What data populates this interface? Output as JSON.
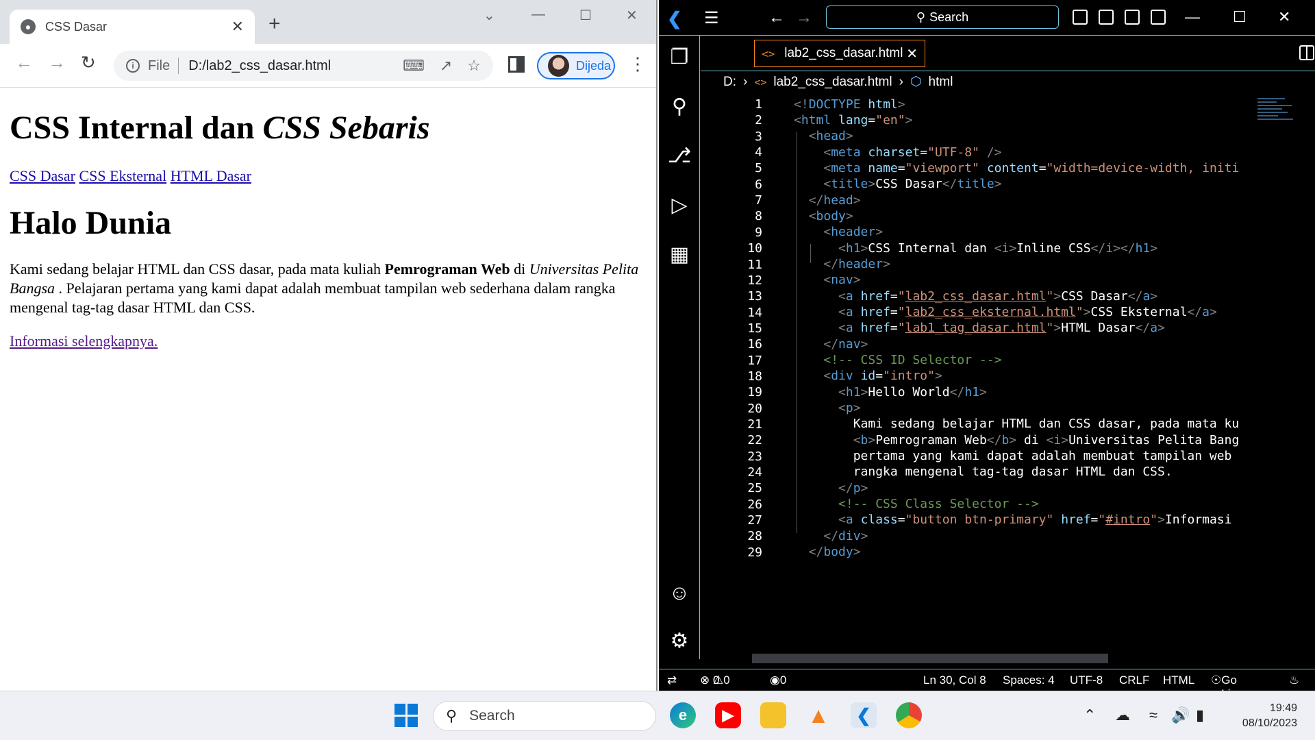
{
  "browser": {
    "tab_title": "CSS Dasar",
    "omnibox_scheme": "File",
    "url": "D:/lab2_css_dasar.html",
    "profile_name": "Dijeda",
    "page": {
      "h1_plain": "CSS Internal dan ",
      "h1_italic": "CSS Sebaris",
      "nav_links": [
        "CSS Dasar",
        "CSS Eksternal",
        "HTML Dasar"
      ],
      "h2": "Halo Dunia",
      "p_part1": "Kami sedang belajar HTML dan CSS dasar, pada mata kuliah ",
      "p_bold": "Pemrograman Web",
      "p_part2": " di ",
      "p_italic": "Universitas Pelita Bangsa",
      "p_part3": " . Pelajaran pertama yang kami dapat adalah membuat tampilan web sederhana dalam rangka mengenal tag-tag dasar HTML dan CSS.",
      "more_link": "Informasi selengkapnya."
    }
  },
  "vscode": {
    "search_label": "Search",
    "file_tab": "lab2_css_dasar.html",
    "breadcrumb": [
      "D:",
      "lab2_css_dasar.html",
      "html"
    ],
    "line_numbers": [
      "1",
      "2",
      "3",
      "4",
      "5",
      "6",
      "7",
      "8",
      "9",
      "10",
      "11",
      "12",
      "13",
      "14",
      "15",
      "16",
      "17",
      "18",
      "19",
      "20",
      "21",
      "22",
      "23",
      "24",
      "25",
      "26",
      "27",
      "28",
      "29"
    ],
    "status": {
      "errors": "0",
      "warnings": "0",
      "ports": "0",
      "position": "Ln 30, Col 8",
      "spaces": "Spaces: 4",
      "encoding": "UTF-8",
      "eol": "CRLF",
      "language": "HTML",
      "golive": "Go Live"
    }
  },
  "taskbar": {
    "search_label": "Search",
    "time": "19:49",
    "date": "08/10/2023"
  }
}
